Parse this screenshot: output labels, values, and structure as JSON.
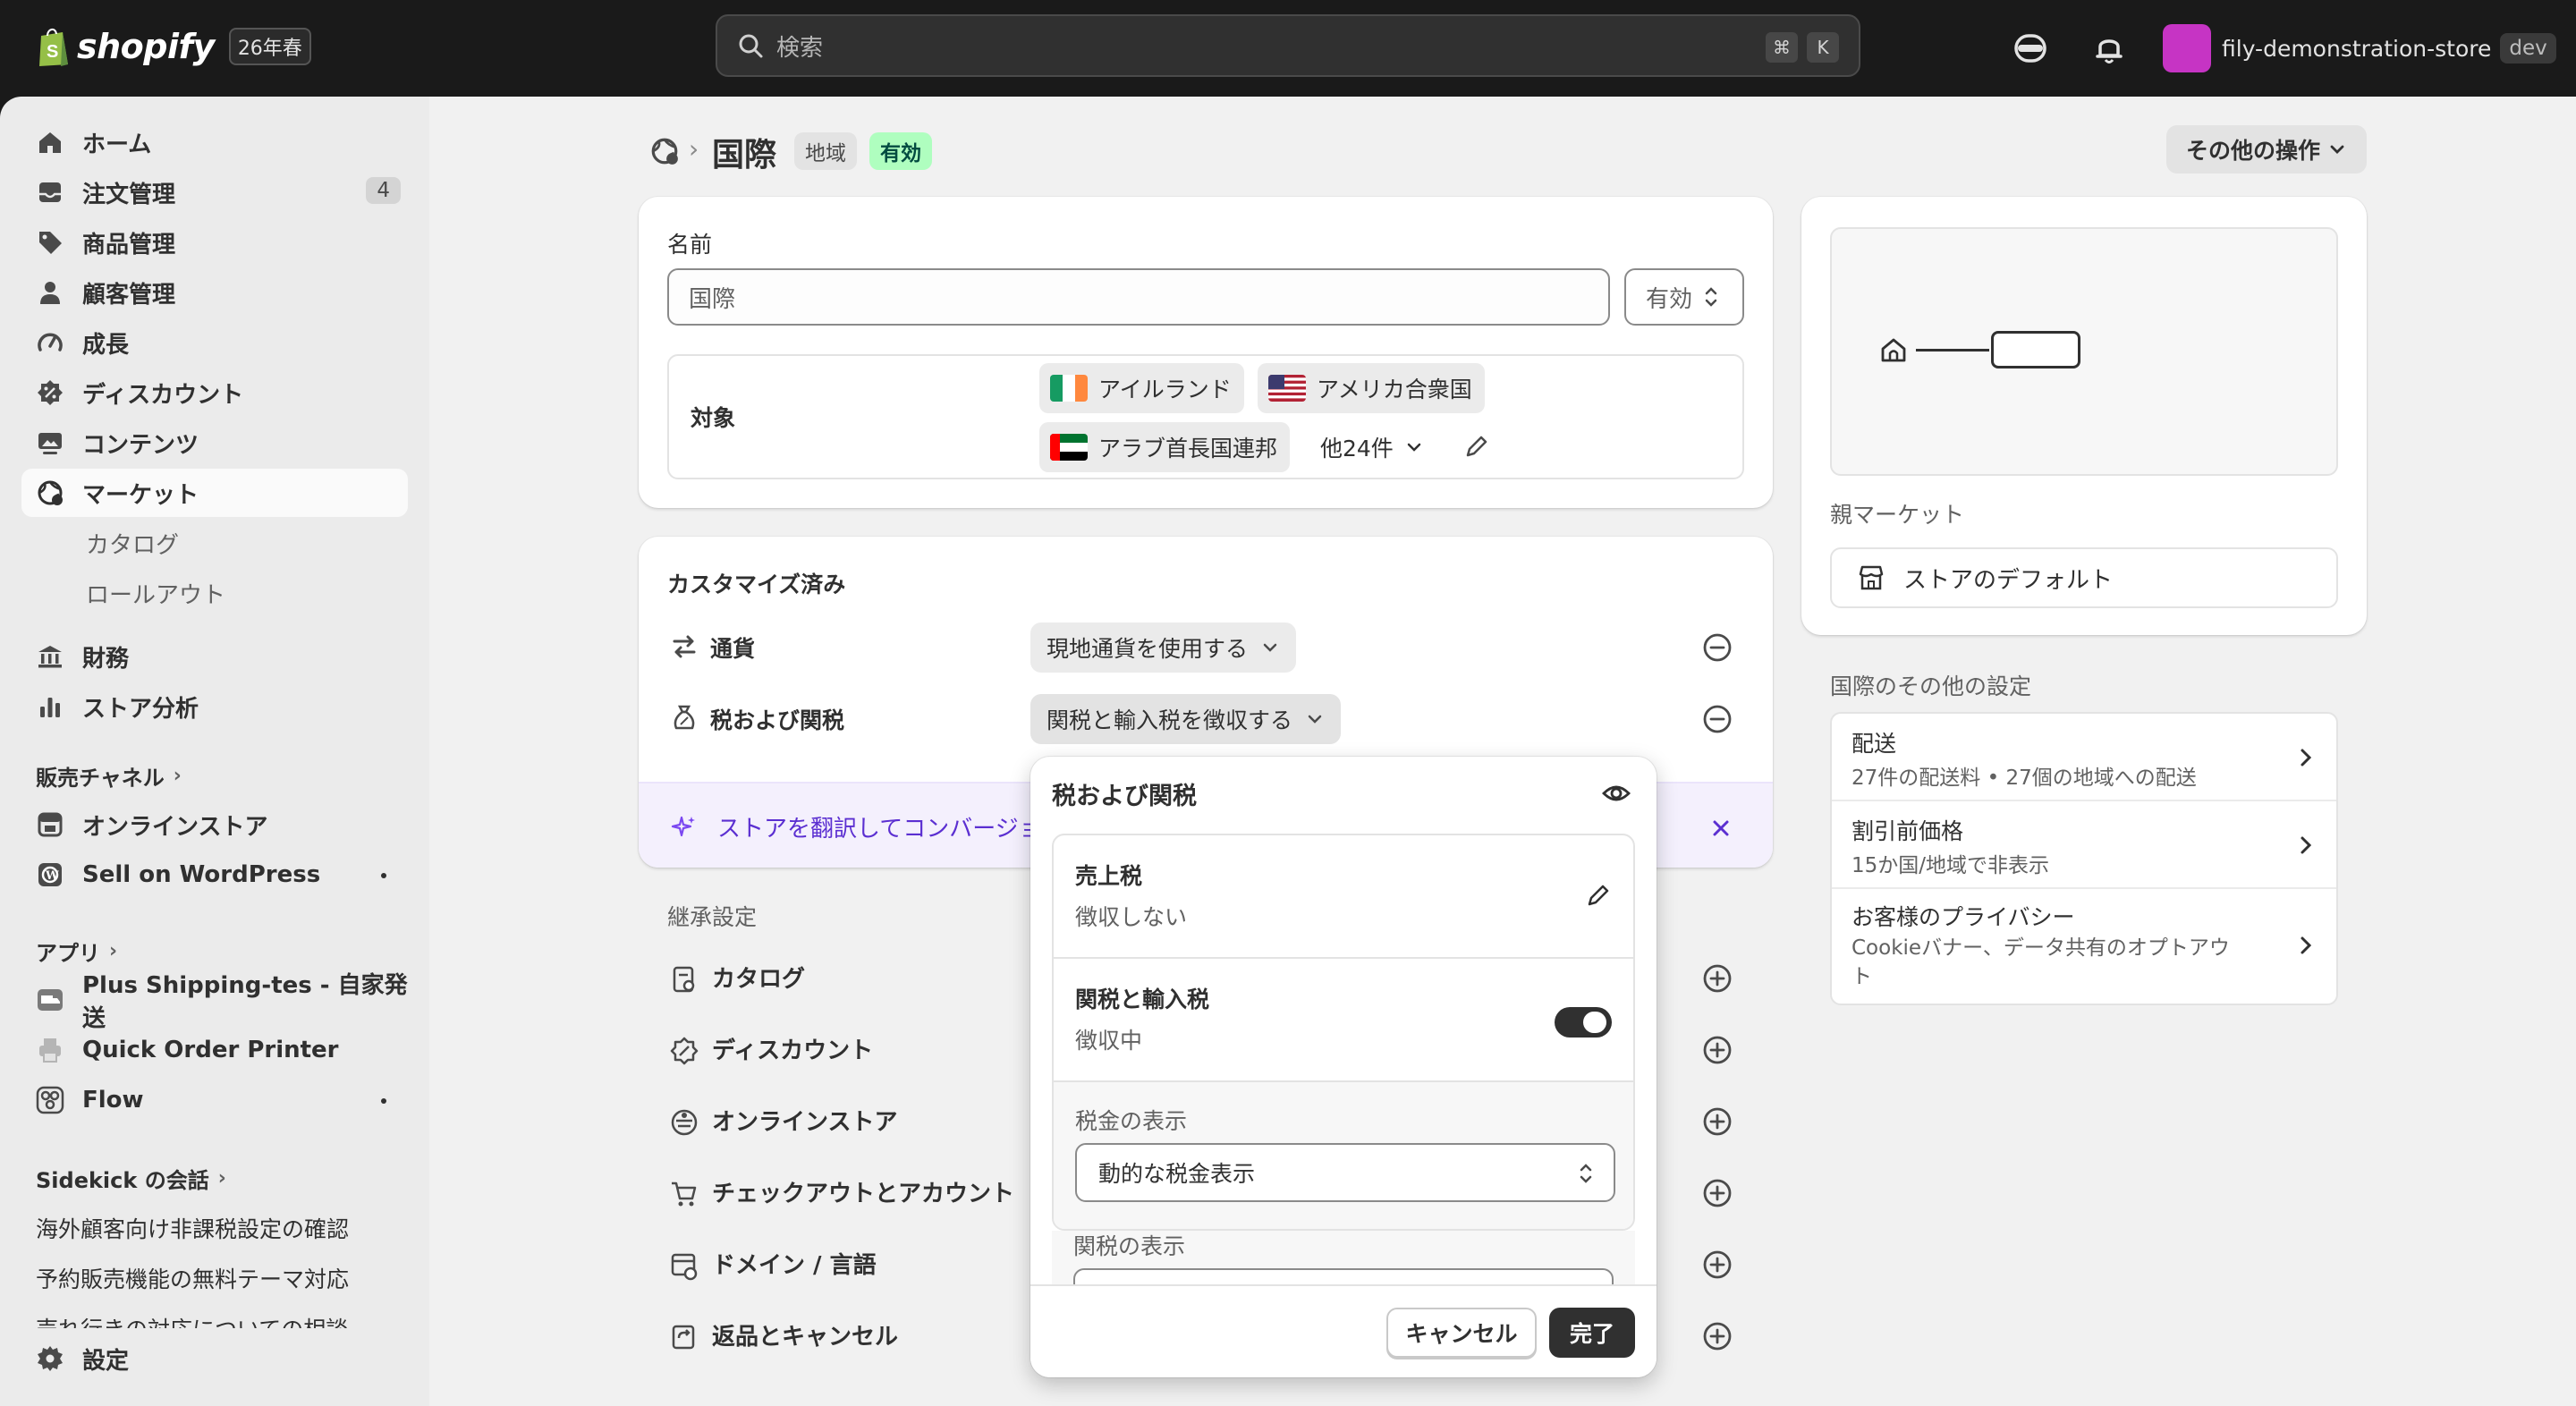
{
  "topbar": {
    "brand": "shopify",
    "season": "26年春",
    "search_placeholder": "検索",
    "shortcut_cmd": "⌘",
    "shortcut_key": "K",
    "store_name": "fily-demonstration-store",
    "store_tag": "dev",
    "store_avatar_color": "#c634c4"
  },
  "sidebar": {
    "items": [
      {
        "label": "ホーム",
        "icon": "home-icon"
      },
      {
        "label": "注文管理",
        "icon": "inbox-icon",
        "badge": "4"
      },
      {
        "label": "商品管理",
        "icon": "tag-icon"
      },
      {
        "label": "顧客管理",
        "icon": "person-icon"
      },
      {
        "label": "成長",
        "icon": "gauge-icon"
      },
      {
        "label": "ディスカウント",
        "icon": "discount-icon"
      },
      {
        "label": "コンテンツ",
        "icon": "image-icon"
      },
      {
        "label": "マーケット",
        "icon": "globe-icon"
      }
    ],
    "market_sub": [
      "カタログ",
      "ロールアウト"
    ],
    "items2": [
      {
        "label": "財務",
        "icon": "bank-icon"
      },
      {
        "label": "ストア分析",
        "icon": "bar-chart-icon"
      }
    ],
    "sales_channels_title": "販売チャネル",
    "channels": [
      {
        "label": "オンラインストア",
        "icon": "store-icon"
      },
      {
        "label": "Sell on WordPress",
        "icon": "wordpress-icon"
      }
    ],
    "apps_title": "アプリ",
    "apps": [
      {
        "label": "Plus Shipping-tes - 自家発送",
        "icon": "truck-app-icon"
      },
      {
        "label": "Quick Order Printer",
        "icon": "printer-app-icon"
      },
      {
        "label": "Flow",
        "icon": "flow-app-icon"
      }
    ],
    "sidekick_title": "Sidekick の会話",
    "conversations": [
      "海外顧客向け非課税設定の確認",
      "予約販売機能の無料テーマ対応",
      "売れ行きの対応についての相談"
    ],
    "settings": "設定"
  },
  "header": {
    "title": "国際",
    "tag_region": "地域",
    "tag_status": "有効",
    "more_actions": "その他の操作"
  },
  "name_card": {
    "label": "名前",
    "value": "国際",
    "status_select": "有効",
    "target_label": "対象",
    "countries": [
      "アイルランド",
      "アメリカ合衆国",
      "アラブ首長国連邦"
    ],
    "more": "他24件"
  },
  "custom_card": {
    "title": "カスタマイズ済み",
    "currency_label": "通貨",
    "currency_value": "現地通貨を使用する",
    "tax_label": "税および関税",
    "tax_value": "関税と輸入税を徴収する",
    "banner_text": "ストアを翻訳してコンバージョン率を向上"
  },
  "inherited": {
    "title": "継承設定",
    "rows": [
      {
        "label": "カタログ",
        "icon": "catalog-icon"
      },
      {
        "label": "ディスカウント",
        "icon": "discount-icon"
      },
      {
        "label": "オンラインストア",
        "icon": "store-icon"
      },
      {
        "label": "チェックアウトとアカウント",
        "icon": "cart-icon"
      },
      {
        "label": "ドメイン / 言語",
        "icon": "domain-icon"
      },
      {
        "label": "返品とキャンセル",
        "icon": "return-icon"
      }
    ]
  },
  "popover": {
    "title": "税および関税",
    "sales_tax_label": "売上税",
    "sales_tax_value": "徴収しない",
    "duties_label": "関税と輸入税",
    "duties_value": "徴収中",
    "duties_enabled": true,
    "tax_display_label": "税金の表示",
    "tax_display_value": "動的な税金表示",
    "duty_display_label": "関税の表示",
    "cancel": "キャンセル",
    "done": "完了"
  },
  "right": {
    "parent_label": "親マーケット",
    "parent_value": "ストアのデフォルト",
    "other_title": "国際のその他の設定",
    "links": [
      {
        "title": "配送",
        "sub": "27件の配送料 • 27個の地域への配送"
      },
      {
        "title": "割引前価格",
        "sub": "15か国/地域で非表示"
      },
      {
        "title": "お客様のプライバシー",
        "sub": "Cookieバナー、データ共有のオプトアウト"
      }
    ]
  }
}
